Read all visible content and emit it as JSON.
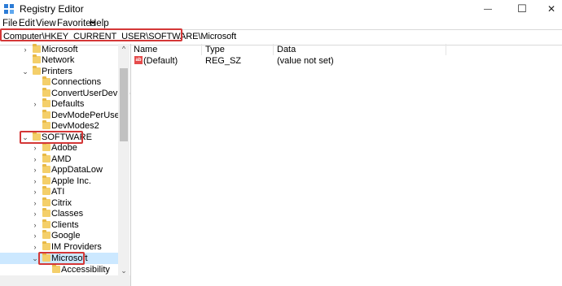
{
  "window": {
    "title": "Registry Editor",
    "minimize_glyph": "—",
    "maximize_glyph": "☐",
    "close_glyph": "✕"
  },
  "menu": [
    "File",
    "Edit",
    "View",
    "Favorites",
    "Help"
  ],
  "address": "Computer\\HKEY_CURRENT_USER\\SOFTWARE\\Microsoft",
  "tree": [
    {
      "label": "Microsoft",
      "expander": "›",
      "depth": 1
    },
    {
      "label": "Network",
      "expander": "",
      "depth": 1
    },
    {
      "label": "Printers",
      "expander": "⌄",
      "depth": 1
    },
    {
      "label": "Connections",
      "expander": "",
      "depth": 2
    },
    {
      "label": "ConvertUserDevMod",
      "expander": "",
      "depth": 2
    },
    {
      "label": "Defaults",
      "expander": "›",
      "depth": 2
    },
    {
      "label": "DevModePerUser",
      "expander": "",
      "depth": 2
    },
    {
      "label": "DevModes2",
      "expander": "",
      "depth": 2
    },
    {
      "label": "SOFTWARE",
      "expander": "⌄",
      "depth": 1
    },
    {
      "label": "Adobe",
      "expander": "›",
      "depth": 2
    },
    {
      "label": "AMD",
      "expander": "›",
      "depth": 2
    },
    {
      "label": "AppDataLow",
      "expander": "›",
      "depth": 2
    },
    {
      "label": "Apple Inc.",
      "expander": "›",
      "depth": 2
    },
    {
      "label": "ATI",
      "expander": "›",
      "depth": 2
    },
    {
      "label": "Citrix",
      "expander": "›",
      "depth": 2
    },
    {
      "label": "Classes",
      "expander": "›",
      "depth": 2
    },
    {
      "label": "Clients",
      "expander": "›",
      "depth": 2
    },
    {
      "label": "Google",
      "expander": "›",
      "depth": 2
    },
    {
      "label": "IM Providers",
      "expander": "›",
      "depth": 2
    },
    {
      "label": "Microsoft",
      "expander": "⌄",
      "depth": 2
    },
    {
      "label": "Accessibility",
      "expander": "",
      "depth": 3
    }
  ],
  "columns": {
    "name": "Name",
    "type": "Type",
    "data": "Data"
  },
  "values": [
    {
      "icon": "ab",
      "name": "(Default)",
      "type": "REG_SZ",
      "data": "(value not set)"
    }
  ],
  "scroll_glyphs": {
    "up": "^",
    "down": "⌄"
  },
  "colors": {
    "highlight": "#d43737",
    "folder": "#f4cf6a"
  }
}
